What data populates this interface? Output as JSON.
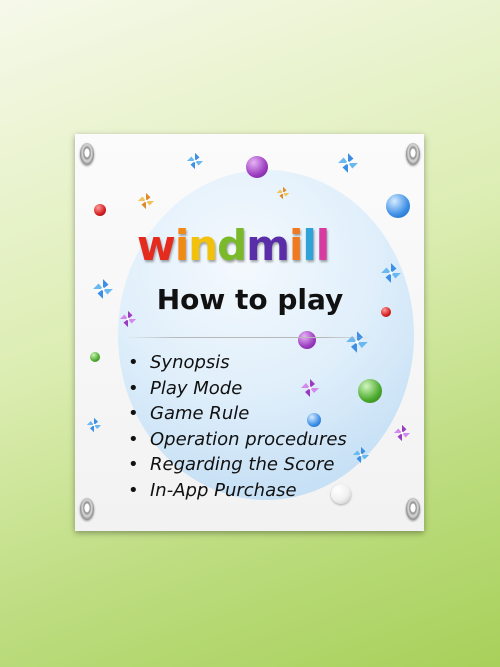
{
  "app": {
    "logo_letters": [
      {
        "char": "w",
        "color": "#e52b1e"
      },
      {
        "char": "i",
        "color": "#f18a13"
      },
      {
        "char": "n",
        "color": "#f1c10c"
      },
      {
        "char": "d",
        "color": "#7ab92a"
      },
      {
        "char": "m",
        "color": "#5a2ea8"
      },
      {
        "char": "i",
        "color": "#ef7a22"
      },
      {
        "char": "l",
        "color": "#2fa3d9"
      },
      {
        "char": "l",
        "color": "#d73aa0"
      }
    ],
    "title": "How to play"
  },
  "menu": {
    "bullet": "•",
    "items": [
      {
        "label": "Synopsis"
      },
      {
        "label": "Play Mode"
      },
      {
        "label": "Game Rule"
      },
      {
        "label": "Operation procedures"
      },
      {
        "label": "Regarding the Score"
      },
      {
        "label": "In-App Purchase"
      }
    ]
  },
  "decor": {
    "pinwheel_icon": "pinwheel-icon",
    "ball_colors": [
      "#9b3cc0",
      "#d21f1f",
      "#3c8ee6",
      "#4caa2e",
      "#ffffff"
    ]
  }
}
